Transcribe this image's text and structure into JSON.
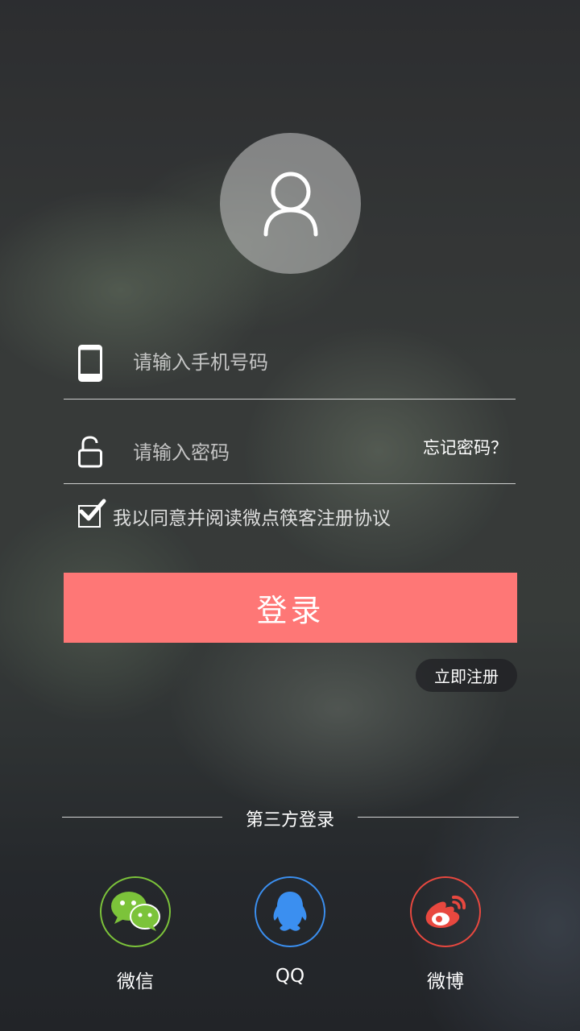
{
  "login_form": {
    "phone_placeholder": "请输入手机号码",
    "password_placeholder": "请输入密码",
    "forgot_label": "忘记密码？",
    "agreement_text": "我以同意并阅读微点筷客注册协议",
    "agreement_checked": true,
    "login_label": "登录",
    "register_label": "立即注册"
  },
  "third_party": {
    "title": "第三方登录",
    "providers": [
      {
        "label": "微信",
        "icon": "wechat-icon",
        "color": "#7cc33a"
      },
      {
        "label": "QQ",
        "icon": "qq-icon",
        "color": "#3b8ff0"
      },
      {
        "label": "微博",
        "icon": "weibo-icon",
        "color": "#e8483f"
      }
    ]
  },
  "colors": {
    "login_button": "#fe7776"
  }
}
